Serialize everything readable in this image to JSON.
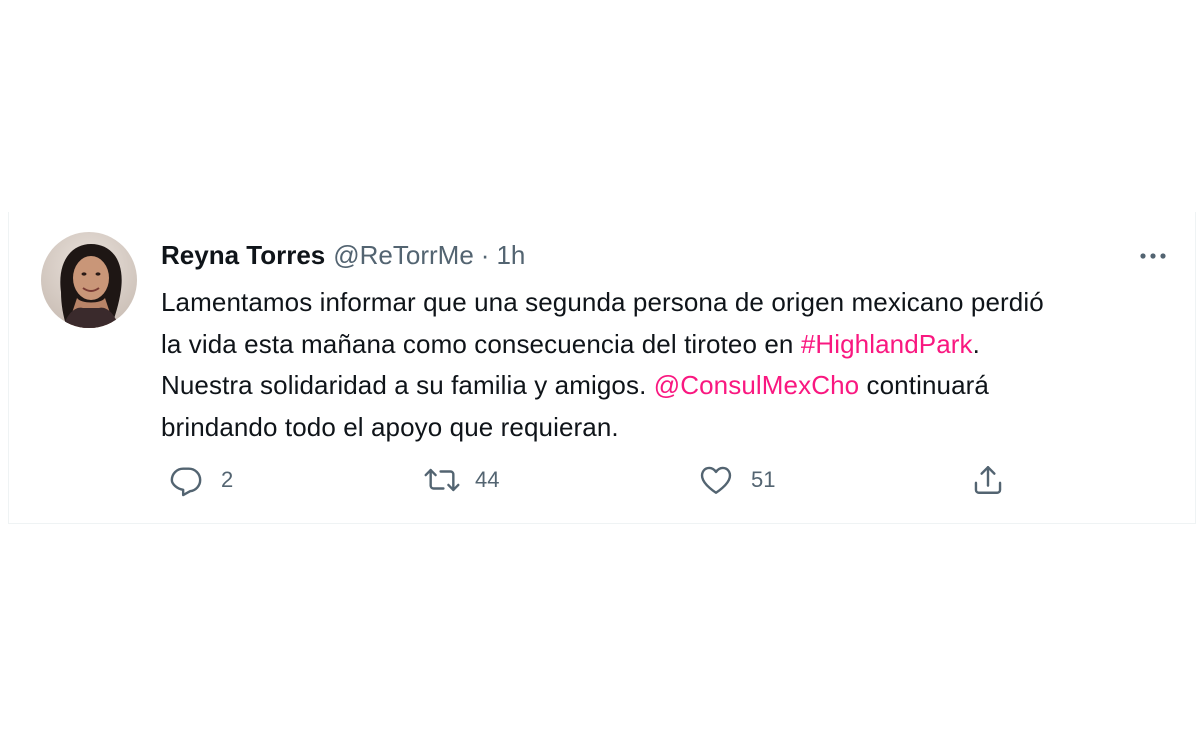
{
  "tweet": {
    "display_name": "Reyna Torres",
    "handle": "@ReTorrMe",
    "separator": "·",
    "time": "1h",
    "text_lines": {
      "l1": "Lamentamos informar que una segunda persona de origen mexicano perdió",
      "l2_before": "la vida esta mañana como consecuencia del  tiroteo en ",
      "l2_hashtag": "#HighlandPark",
      "l2_after": ".",
      "l3_before": "Nuestra solidaridad a su familia y amigos. ",
      "l3_mention": "@ConsulMexCho",
      "l3_after": " continuará",
      "l4": "brindando todo el apoyo que requieran."
    },
    "icons": {
      "avatar": "profile-photo",
      "more": "more-icon",
      "reply": "reply-icon",
      "retweet": "retweet-icon",
      "like": "heart-icon",
      "share": "share-icon"
    },
    "stats": {
      "replies": "2",
      "retweets": "44",
      "likes": "51"
    },
    "colors": {
      "text": "#0f1419",
      "secondary": "#536471",
      "link": "#f91880",
      "border": "#eff3f4"
    }
  }
}
